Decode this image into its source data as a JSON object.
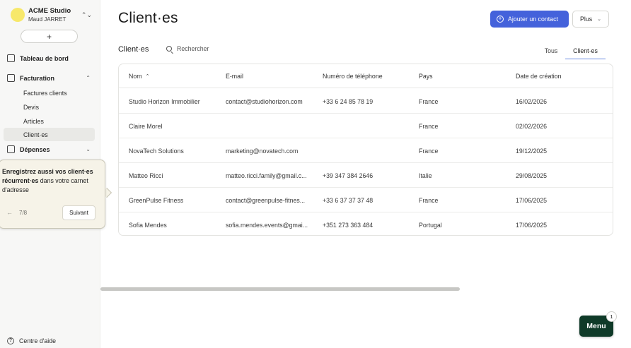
{
  "workspace": {
    "name": "ACME Studio",
    "user": "Maud JARRET"
  },
  "sidebar": {
    "new_label": "+",
    "items": [
      {
        "label": "Tableau de bord"
      },
      {
        "label": "Facturation",
        "sub": [
          "Factures clients",
          "Devis",
          "Articles",
          "Client·es"
        ]
      },
      {
        "label": "Dépenses"
      }
    ],
    "active_sub": "Client·es",
    "help_label": "Centre d'aide"
  },
  "tooltip": {
    "bold_1": "Enregistrez aussi vos client·es",
    "bold_2": "récurrent·es",
    "rest": " dans votre carnet d'adresse",
    "prev_icon": "arrow-left-icon",
    "step": "7/8",
    "next_label": "Suivant"
  },
  "header": {
    "title": "Client·es",
    "add_label": "Ajouter un contact",
    "more_label": "Plus"
  },
  "section": {
    "title": "Client·es",
    "search_label": "Rechercher",
    "filters": [
      "Tous",
      "Client·es"
    ],
    "active_filter": "Client·es"
  },
  "table": {
    "columns": [
      "Nom",
      "E-mail",
      "Numéro de téléphone",
      "Pays",
      "Date de création"
    ],
    "sort_column": "Nom",
    "rows": [
      [
        "Studio Horizon Immobilier",
        "contact@studiohorizon.com",
        "+33 6 24 85 78 19",
        "France",
        "16/02/2026"
      ],
      [
        "Claire Morel",
        "",
        "",
        "France",
        "02/02/2026"
      ],
      [
        "NovaTech Solutions",
        "marketing@novatech.com",
        "",
        "France",
        "19/12/2025"
      ],
      [
        "Matteo Ricci",
        "matteo.ricci.family@gmail.c...",
        "+39 347 384 2646",
        "Italie",
        "29/08/2025"
      ],
      [
        "GreenPulse Fitness",
        "contact@greenpulse-fitnes...",
        "+33 6 37 37 37 48",
        "France",
        "17/06/2025"
      ],
      [
        "Sofia Mendes",
        "sofia.mendes.events@gmai...",
        "+351 273 363 484",
        "Portugal",
        "17/06/2025"
      ]
    ]
  },
  "menu": {
    "label": "Menu",
    "badge": "1"
  },
  "colors": {
    "primary": "#4462db",
    "menu_bg": "#0f3a28",
    "avatar": "#f7e86a",
    "tooltip_bg": "#f6f3e8"
  }
}
